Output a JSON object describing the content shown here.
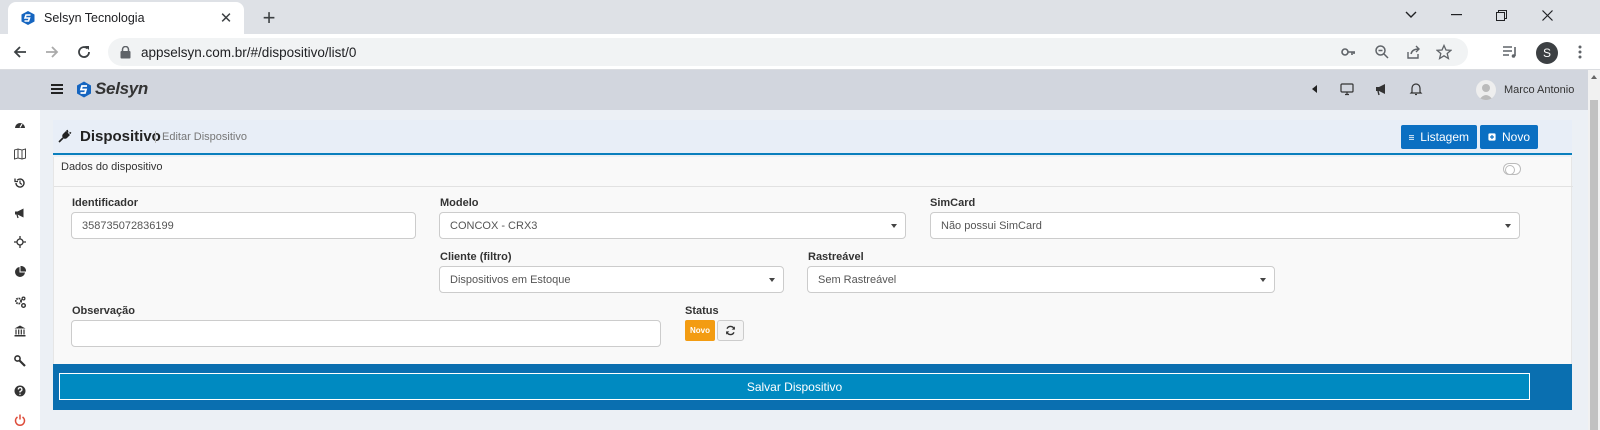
{
  "browser": {
    "tab_title": "Selsyn Tecnologia",
    "url": "appselsyn.com.br/#/dispositivo/list/0",
    "profile_initial": "S"
  },
  "header": {
    "logo_text": "Selsyn",
    "user_name": "Marco Antonio"
  },
  "page": {
    "title": "Dispositivo",
    "subtitle": "Editar Dispositivo",
    "btn_list": "Listagem",
    "btn_new": "Novo"
  },
  "form": {
    "section_title": "Dados do dispositivo",
    "identificador_label": "Identificador",
    "identificador_value": "358735072836199",
    "modelo_label": "Modelo",
    "modelo_value": "CONCOX - CRX3",
    "simcard_label": "SimCard",
    "simcard_value": "Não possui SimCard",
    "cliente_label": "Cliente (filtro)",
    "cliente_value": "Dispositivos em Estoque",
    "rastreavel_label": "Rastreável",
    "rastreavel_value": "Sem Rastreável",
    "observacao_label": "Observação",
    "observacao_value": "",
    "status_label": "Status",
    "status_badge": "Novo",
    "save_label": "Salvar Dispositivo"
  },
  "colors": {
    "primary": "#0a6fc2",
    "save": "#008ac1",
    "status_new": "#f39c12",
    "header_bg": "#d2d6de"
  },
  "icons": {
    "sidebar": [
      "dashboard-icon",
      "map-icon",
      "history-icon",
      "megaphone-icon",
      "crosshair-icon",
      "pie-chart-icon",
      "gears-icon",
      "bank-icon",
      "wrench-icon",
      "help-icon",
      "power-icon"
    ]
  }
}
